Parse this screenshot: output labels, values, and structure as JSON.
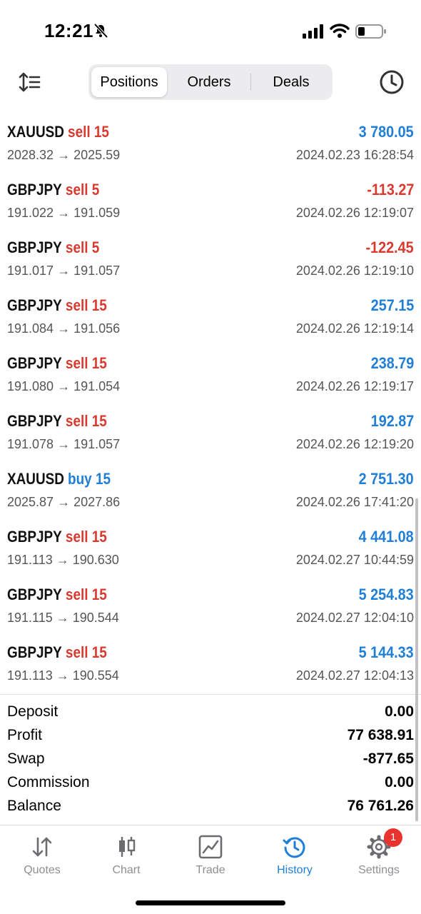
{
  "status": {
    "time": "12:21"
  },
  "segments": {
    "positions": "Positions",
    "orders": "Orders",
    "deals": "Deals"
  },
  "deals": [
    {
      "symbol": "XAUUSD",
      "side": "sell 15",
      "type": "sell",
      "profit": "3 780.05",
      "sign": "pos",
      "prices": "2028.32 → 2025.59",
      "time": "2024.02.23 16:28:54"
    },
    {
      "symbol": "GBPJPY",
      "side": "sell 5",
      "type": "sell",
      "profit": "-113.27",
      "sign": "neg",
      "prices": "191.022 → 191.059",
      "time": "2024.02.26 12:19:07"
    },
    {
      "symbol": "GBPJPY",
      "side": "sell 5",
      "type": "sell",
      "profit": "-122.45",
      "sign": "neg",
      "prices": "191.017 → 191.057",
      "time": "2024.02.26 12:19:10"
    },
    {
      "symbol": "GBPJPY",
      "side": "sell 15",
      "type": "sell",
      "profit": "257.15",
      "sign": "pos",
      "prices": "191.084 → 191.056",
      "time": "2024.02.26 12:19:14"
    },
    {
      "symbol": "GBPJPY",
      "side": "sell 15",
      "type": "sell",
      "profit": "238.79",
      "sign": "pos",
      "prices": "191.080 → 191.054",
      "time": "2024.02.26 12:19:17"
    },
    {
      "symbol": "GBPJPY",
      "side": "sell 15",
      "type": "sell",
      "profit": "192.87",
      "sign": "pos",
      "prices": "191.078 → 191.057",
      "time": "2024.02.26 12:19:20"
    },
    {
      "symbol": "XAUUSD",
      "side": "buy 15",
      "type": "buy",
      "profit": "2 751.30",
      "sign": "pos",
      "prices": "2025.87 → 2027.86",
      "time": "2024.02.26 17:41:20"
    },
    {
      "symbol": "GBPJPY",
      "side": "sell 15",
      "type": "sell",
      "profit": "4 441.08",
      "sign": "pos",
      "prices": "191.113 → 190.630",
      "time": "2024.02.27 10:44:59"
    },
    {
      "symbol": "GBPJPY",
      "side": "sell 15",
      "type": "sell",
      "profit": "5 254.83",
      "sign": "pos",
      "prices": "191.115 → 190.544",
      "time": "2024.02.27 12:04:10"
    },
    {
      "symbol": "GBPJPY",
      "side": "sell 15",
      "type": "sell",
      "profit": "5 144.33",
      "sign": "pos",
      "prices": "191.113 → 190.554",
      "time": "2024.02.27 12:04:13"
    }
  ],
  "summary": [
    {
      "label": "Deposit",
      "value": "0.00"
    },
    {
      "label": "Profit",
      "value": "77 638.91"
    },
    {
      "label": "Swap",
      "value": "-877.65"
    },
    {
      "label": "Commission",
      "value": "0.00"
    },
    {
      "label": "Balance",
      "value": "76 761.26"
    }
  ],
  "tabs": [
    {
      "label": "Quotes",
      "icon": "quotes-arrows-icon"
    },
    {
      "label": "Chart",
      "icon": "candlestick-icon"
    },
    {
      "label": "Trade",
      "icon": "trade-chart-icon"
    },
    {
      "label": "History",
      "icon": "history-clock-icon",
      "active": true
    },
    {
      "label": "Settings",
      "icon": "gear-icon",
      "badge": "1"
    }
  ],
  "colors": {
    "sell": "#d9392e",
    "buy": "#1f7fd6",
    "accent": "#1f7fd6",
    "badge": "#e8332e"
  }
}
